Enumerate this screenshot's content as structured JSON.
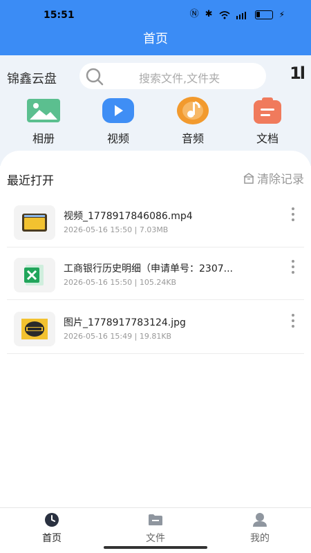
{
  "status_bar": {
    "time": "15:51"
  },
  "header": {
    "title": "首页"
  },
  "brand": {
    "name": "锦鑫云盘"
  },
  "search": {
    "placeholder": "搜索文件,文件夹"
  },
  "sort_label": "1l",
  "categories": [
    {
      "label": "相册",
      "icon": "image-icon",
      "color": "#5bbf8f"
    },
    {
      "label": "视频",
      "icon": "video-play-icon",
      "color": "#3f8ef5"
    },
    {
      "label": "音频",
      "icon": "music-note-icon",
      "color": "#f29a2e"
    },
    {
      "label": "文档",
      "icon": "document-icon",
      "color": "#f07a5c"
    }
  ],
  "recent": {
    "title": "最近打开",
    "clear_label": "清除记录",
    "files": [
      {
        "name": "视频_1778917846086.mp4",
        "date": "2026-05-16 15:50",
        "size": "7.03MB",
        "icon": "video-file-icon"
      },
      {
        "name": "工商银行历史明细（申请单号：2307...",
        "date": "2026-05-16 15:50",
        "size": "105.24KB",
        "icon": "excel-file-icon"
      },
      {
        "name": "图片_1778917783124.jpg",
        "date": "2026-05-16 15:49",
        "size": "19.81KB",
        "icon": "image-file-icon"
      }
    ]
  },
  "tabs": [
    {
      "label": "首页",
      "icon": "clock-icon",
      "active": true
    },
    {
      "label": "文件",
      "icon": "folder-icon",
      "active": false
    },
    {
      "label": "我的",
      "icon": "user-icon",
      "active": false
    }
  ],
  "colors": {
    "primary": "#3b8cf5",
    "panel": "#eef3f9",
    "muted": "#999999"
  }
}
